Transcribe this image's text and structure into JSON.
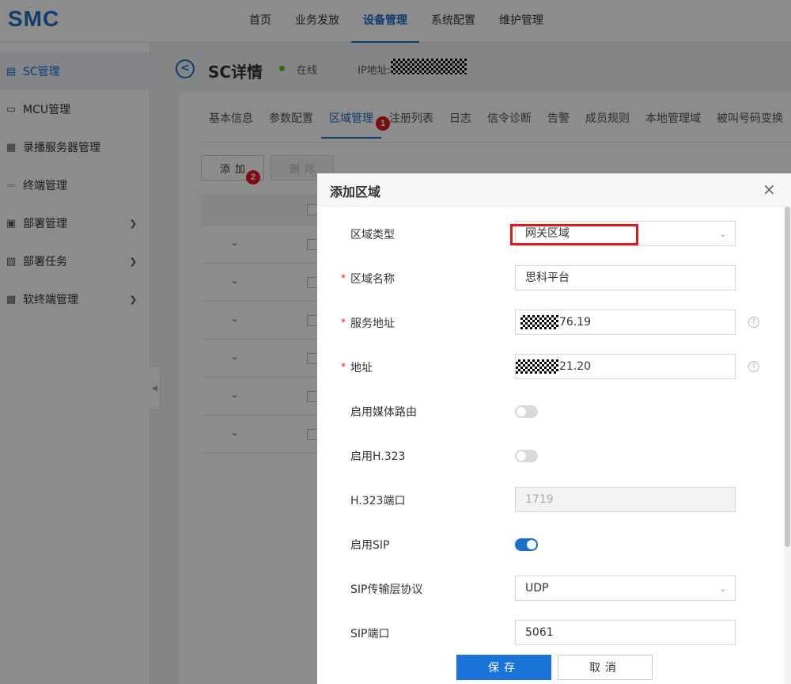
{
  "app": {
    "logo": "SMC"
  },
  "topnav": {
    "items": [
      "首页",
      "业务发放",
      "设备管理",
      "系统配置",
      "维护管理"
    ],
    "active_index": 2
  },
  "sidebar": {
    "items": [
      {
        "label": "SC管理",
        "icon": "server-icon"
      },
      {
        "label": "MCU管理",
        "icon": "monitor-icon"
      },
      {
        "label": "录播服务器管理",
        "icon": "recorder-icon"
      },
      {
        "label": "终端管理",
        "icon": "terminal-icon"
      },
      {
        "label": "部署管理",
        "icon": "deploy-icon"
      },
      {
        "label": "部署任务",
        "icon": "task-icon"
      },
      {
        "label": "软终端管理",
        "icon": "softclient-icon"
      }
    ],
    "active_index": 0
  },
  "header": {
    "title": "SC详情",
    "status": "在线",
    "ip_label": "IP地址:"
  },
  "tabs": {
    "items": [
      "基本信息",
      "参数配置",
      "区域管理",
      "注册列表",
      "日志",
      "信令诊断",
      "告警",
      "成员规则",
      "本地管理域",
      "被叫号码变换"
    ],
    "active_index": 2
  },
  "toolbar": {
    "add_label": "添加",
    "delete_label": "删除"
  },
  "badges": {
    "step1": "1",
    "step2": "2"
  },
  "dialog": {
    "title": "添加区域",
    "close_symbol": "×",
    "fields": {
      "zone_type": {
        "label": "区域类型",
        "value": "网关区域"
      },
      "zone_name": {
        "label": "区域名称",
        "value": "思科平台",
        "required_mark": "*"
      },
      "service_addr": {
        "label": "服务地址",
        "value": "76.19",
        "required_mark": "*"
      },
      "address": {
        "label": "地址",
        "value": "21.20",
        "required_mark": "*"
      },
      "media_route": {
        "label": "启用媒体路由",
        "enabled": false
      },
      "h323": {
        "label": "启用H.323",
        "enabled": false
      },
      "h323_port": {
        "label": "H.323端口",
        "value": "1719"
      },
      "sip": {
        "label": "启用SIP",
        "enabled": true
      },
      "sip_transport": {
        "label": "SIP传输层协议",
        "value": "UDP"
      },
      "sip_port": {
        "label": "SIP端口",
        "value": "5061"
      }
    },
    "help_symbol": "?",
    "save_label": "保存",
    "cancel_label": "取消"
  },
  "colors": {
    "accent": "#1a6fc9",
    "highlight": "#e0191f",
    "online": "#52c41a"
  }
}
